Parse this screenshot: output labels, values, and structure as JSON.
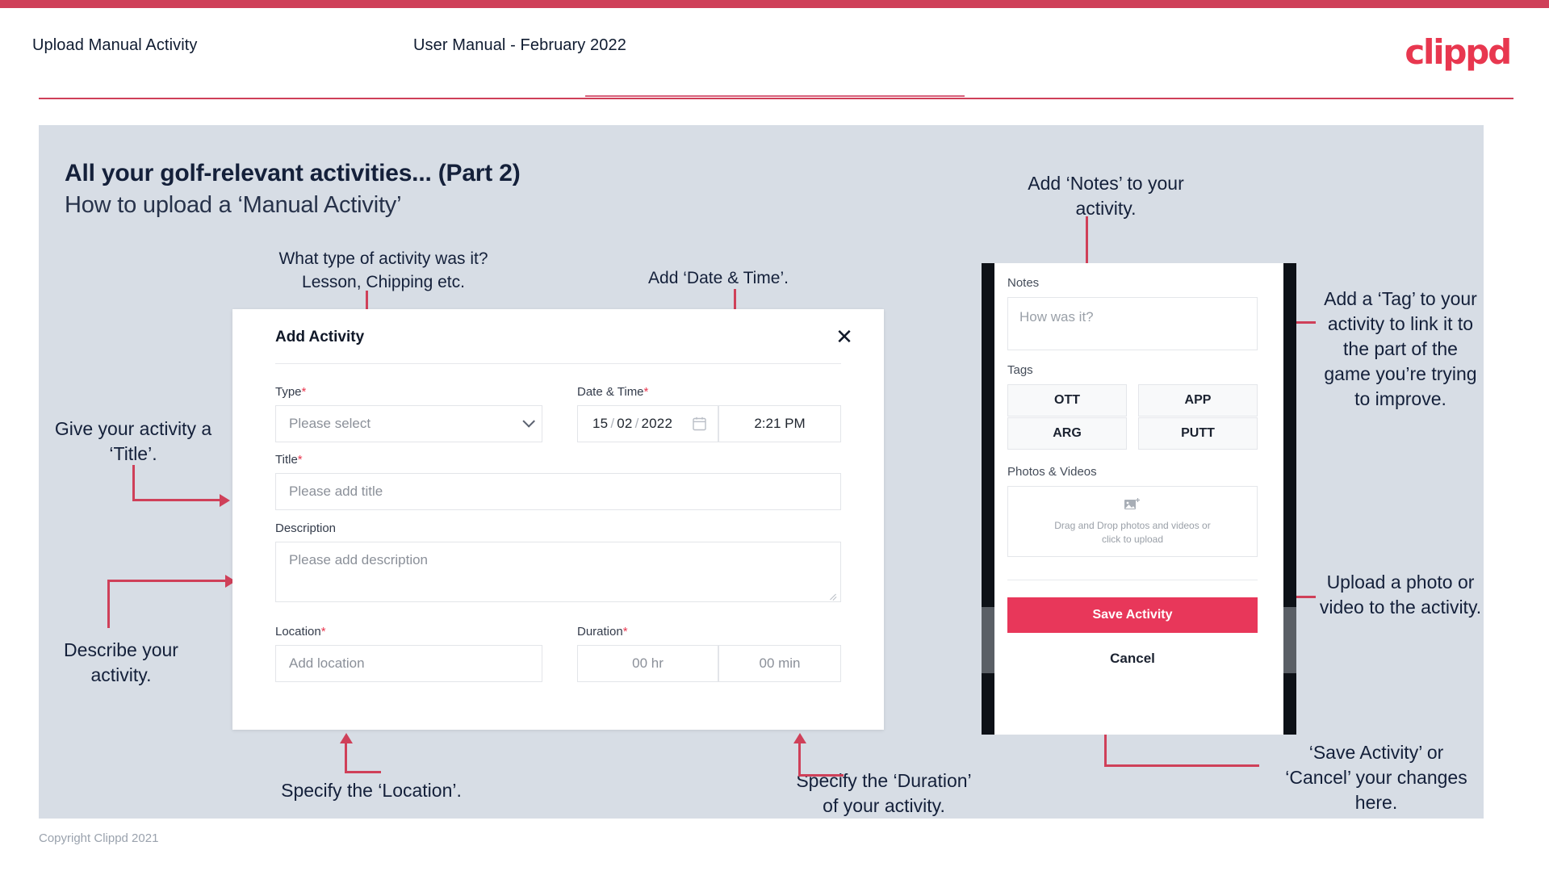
{
  "header": {
    "title": "Upload Manual Activity",
    "subtitle": "User Manual - February 2022",
    "logo": "clippd"
  },
  "slide": {
    "title": "All your golf-relevant activities... (Part 2)",
    "subtitle": "How to upload a ‘Manual Activity’"
  },
  "dialog": {
    "title": "Add Activity",
    "close_icon": "close-icon",
    "fields": {
      "type": {
        "label": "Type",
        "required": "*",
        "placeholder": "Please select"
      },
      "datetime": {
        "label": "Date & Time",
        "required": "*",
        "day": "15",
        "month": "02",
        "year": "2022",
        "sep": "/",
        "time": "2:21 PM"
      },
      "title": {
        "label": "Title",
        "required": "*",
        "placeholder": "Please add title"
      },
      "description": {
        "label": "Description",
        "placeholder": "Please add description"
      },
      "location": {
        "label": "Location",
        "required": "*",
        "placeholder": "Add location"
      },
      "duration": {
        "label": "Duration",
        "required": "*",
        "hours": "00 hr",
        "minutes": "00 min"
      }
    }
  },
  "phone": {
    "notes": {
      "label": "Notes",
      "placeholder": "How was it?"
    },
    "tags": {
      "label": "Tags",
      "items": [
        "OTT",
        "APP",
        "ARG",
        "PUTT"
      ]
    },
    "photos": {
      "label": "Photos & Videos",
      "drop_line1": "Drag and Drop photos and videos or",
      "drop_line2": "click to upload"
    },
    "save_label": "Save Activity",
    "cancel_label": "Cancel"
  },
  "annotations": {
    "type": "What type of activity was it?\nLesson, Chipping etc.",
    "datetime": "Add ‘Date & Time’.",
    "title": "Give your activity a\n‘Title’.",
    "description": "Describe your\nactivity.",
    "location": "Specify the ‘Location’.",
    "duration": "Specify the ‘Duration’\nof your activity.",
    "notes": "Add ‘Notes’ to your\nactivity.",
    "tags": "Add a ‘Tag’ to your\nactivity to link it to\nthe part of the\ngame you’re trying\nto improve.",
    "upload": "Upload a photo or\nvideo to the activity.",
    "save": "‘Save Activity’ or\n‘Cancel’ your changes\nhere."
  },
  "footer": "Copyright Clippd 2021",
  "colors": {
    "accent": "#cf4059",
    "brand": "#e8374f",
    "save_button": "#e8375a",
    "slide_bg": "#d7dde5",
    "text": "#14203a"
  }
}
